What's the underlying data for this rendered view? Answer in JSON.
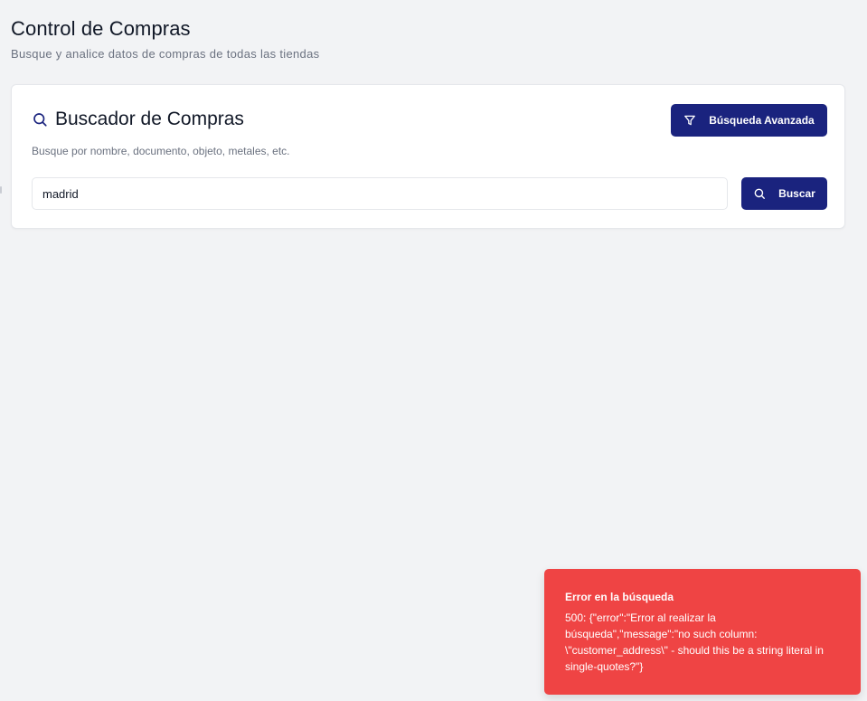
{
  "page": {
    "title": "Control de Compras",
    "subtitle": "Busque y analice datos de compras de todas las tiendas"
  },
  "search_card": {
    "title": "Buscador de Compras",
    "subtitle": "Busque por nombre, documento, objeto, metales, etc.",
    "title_icon": "search-icon",
    "advanced_button": {
      "label": "Búsqueda Avanzada",
      "icon": "filter-icon"
    },
    "search_input": {
      "value": "madrid",
      "placeholder": ""
    },
    "search_button": {
      "label": "Buscar",
      "icon": "search-icon"
    }
  },
  "toast": {
    "title": "Error en la búsqueda",
    "message": "500: {\"error\":\"Error al realizar la búsqueda\",\"message\":\"no such column: \\\"customer_address\\\" - should this be a string literal in single-quotes?\"}"
  },
  "colors": {
    "background": "#f2f3f5",
    "primary": "#1a237e",
    "error": "#ef4444",
    "text": "#111827",
    "muted_text": "#6b7280"
  }
}
